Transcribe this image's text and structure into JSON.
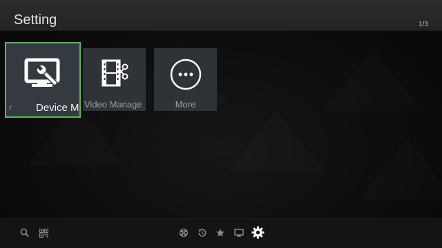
{
  "header": {
    "title": "Setting",
    "page_indicator": "1/3"
  },
  "tiles": [
    {
      "label": "Device M",
      "clipped_prefix": "r",
      "icon": "monitor-wrench-icon",
      "selected": true
    },
    {
      "label": "Video Manage",
      "icon": "film-scissors-icon",
      "selected": false
    },
    {
      "label": "More",
      "icon": "more-dots-icon",
      "selected": false
    }
  ],
  "bottombar": {
    "icons": [
      "search-icon",
      "qr-code-icon",
      "film-reel-icon",
      "history-icon",
      "star-icon",
      "monitor-icon",
      "gear-icon"
    ],
    "active": "gear-icon"
  },
  "colors": {
    "selection_border": "#5cb85c",
    "tile_bg": "#2f3338",
    "header_bg": "#2a2a2a"
  }
}
